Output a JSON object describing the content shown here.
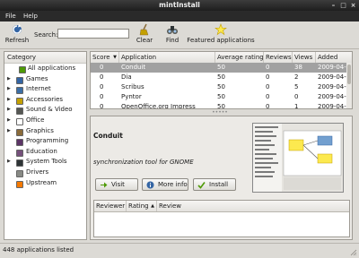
{
  "window": {
    "title": "mintInstall"
  },
  "menubar": {
    "items": [
      "File",
      "Help"
    ]
  },
  "toolbar": {
    "refresh_label": "Refresh",
    "search_label": "Search:",
    "search_value": "",
    "clear_label": "Clear",
    "find_label": "Find",
    "featured_label": "Featured applications"
  },
  "sidebar": {
    "header": "Category",
    "items": [
      {
        "label": "All applications",
        "expander": false,
        "color": "#4e9a06"
      },
      {
        "label": "Games",
        "expander": true,
        "color": "#3465a4"
      },
      {
        "label": "Internet",
        "expander": true,
        "color": "#3b6ea5"
      },
      {
        "label": "Accessories",
        "expander": true,
        "color": "#c4a000"
      },
      {
        "label": "Sound & Video",
        "expander": true,
        "color": "#555753"
      },
      {
        "label": "Office",
        "expander": true,
        "color": "#ffffff"
      },
      {
        "label": "Graphics",
        "expander": true,
        "color": "#8a6b3a"
      },
      {
        "label": "Programming",
        "expander": false,
        "color": "#5c3566"
      },
      {
        "label": "Education",
        "expander": false,
        "color": "#75507b"
      },
      {
        "label": "System Tools",
        "expander": true,
        "color": "#2e3436"
      },
      {
        "label": "Drivers",
        "expander": false,
        "color": "#888a85"
      },
      {
        "label": "Upstream",
        "expander": false,
        "color": "#f57900"
      }
    ]
  },
  "apps_table": {
    "headers": [
      "Score",
      "Application",
      "Average rating",
      "Reviews",
      "Views",
      "Added"
    ],
    "sort_indicator": "▼",
    "rows": [
      [
        "0",
        "Conduit",
        "50",
        "0",
        "38",
        "2009-04-1"
      ],
      [
        "0",
        "Dia",
        "50",
        "0",
        "2",
        "2009-04-15"
      ],
      [
        "0",
        "Scribus",
        "50",
        "0",
        "5",
        "2009-04-15"
      ],
      [
        "0",
        "Pyntor",
        "50",
        "0",
        "0",
        "2009-04-15"
      ],
      [
        "0",
        "OpenOffice.org Impress",
        "50",
        "0",
        "1",
        "2009-04-15"
      ]
    ],
    "selected_row": 0
  },
  "detail": {
    "app_name": "Conduit",
    "description": "synchronization tool for GNOME",
    "visit_label": "Visit",
    "more_info_label": "More info",
    "install_label": "Install"
  },
  "reviews_table": {
    "headers": [
      "Reviewer",
      "Rating",
      "Review"
    ],
    "sort_indicator": "▲"
  },
  "status": {
    "text": "448 applications listed"
  },
  "colors": {
    "title_bg": "#2a2a2a",
    "selection": "#a1a1a1",
    "accent_green": "#4e9a06"
  }
}
